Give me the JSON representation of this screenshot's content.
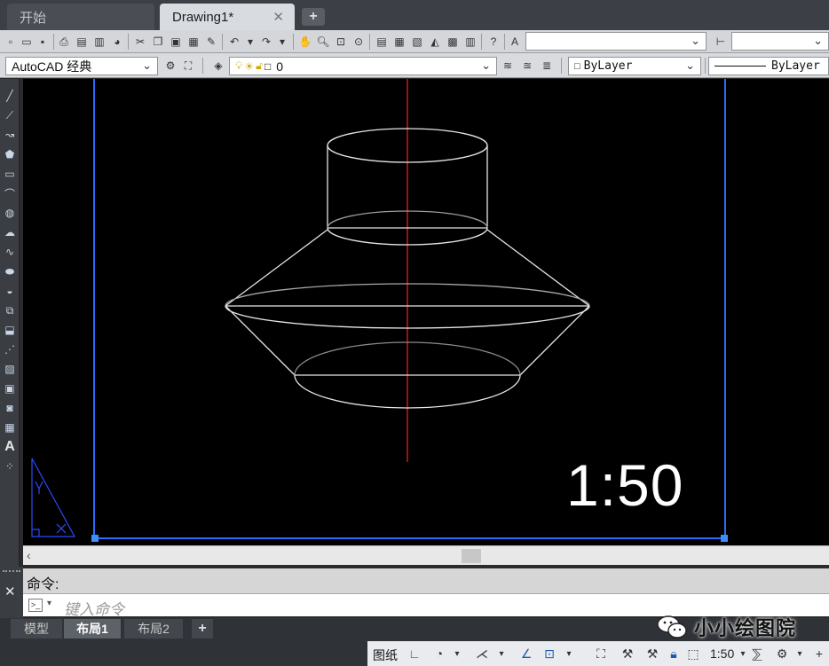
{
  "tabs": {
    "start": "开始",
    "drawing": "Drawing1*",
    "close": "✕",
    "add": "+"
  },
  "toolbar": {
    "workspace": "AutoCAD 经典",
    "layer": "0",
    "color": "ByLayer",
    "linetype": "ByLayer"
  },
  "palette": {
    "text_tool": "A"
  },
  "canvas": {
    "scale_text": "1:50"
  },
  "command": {
    "history": "命令:",
    "placeholder": "键入命令",
    "close": "✕"
  },
  "layout_tabs": {
    "model": "模型",
    "layout1": "布局1",
    "layout2": "布局2",
    "add": "+"
  },
  "status": {
    "paper": "图纸",
    "scale": "1:50"
  },
  "watermark": {
    "text": "小小绘图院"
  },
  "colors": {
    "canvas_bg": "#000000",
    "viewport_frame": "#2d6cff",
    "centerline": "#ff2020",
    "geometry": "#e6e6e6"
  }
}
